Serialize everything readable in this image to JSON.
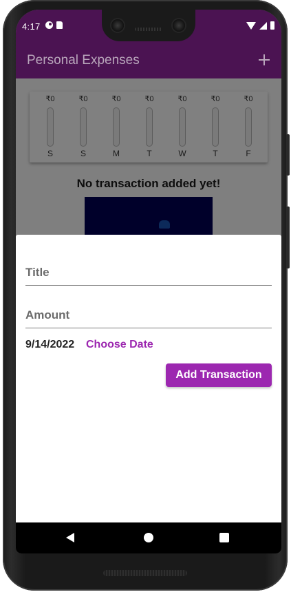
{
  "status_bar": {
    "time": "4:17"
  },
  "app_bar": {
    "title": "Personal Expenses",
    "add_icon": "plus-icon"
  },
  "chart": {
    "bars": [
      {
        "amount": "₹0",
        "day": "S",
        "fill": 0
      },
      {
        "amount": "₹0",
        "day": "S",
        "fill": 0
      },
      {
        "amount": "₹0",
        "day": "M",
        "fill": 0
      },
      {
        "amount": "₹0",
        "day": "T",
        "fill": 0
      },
      {
        "amount": "₹0",
        "day": "W",
        "fill": 0
      },
      {
        "amount": "₹0",
        "day": "T",
        "fill": 0
      },
      {
        "amount": "₹0",
        "day": "F",
        "fill": 0
      }
    ]
  },
  "empty_state": {
    "message": "No transaction added yet!"
  },
  "sheet": {
    "title_label": "Title",
    "amount_label": "Amount",
    "date_value": "9/14/2022",
    "choose_date_label": "Choose Date",
    "add_button_label": "Add Transaction"
  },
  "colors": {
    "primary": "#9c27b0",
    "app_bar": "#4b1352"
  },
  "nav": {
    "back_icon": "back-triangle-icon",
    "home_icon": "home-circle-icon",
    "recents_icon": "recents-square-icon"
  }
}
